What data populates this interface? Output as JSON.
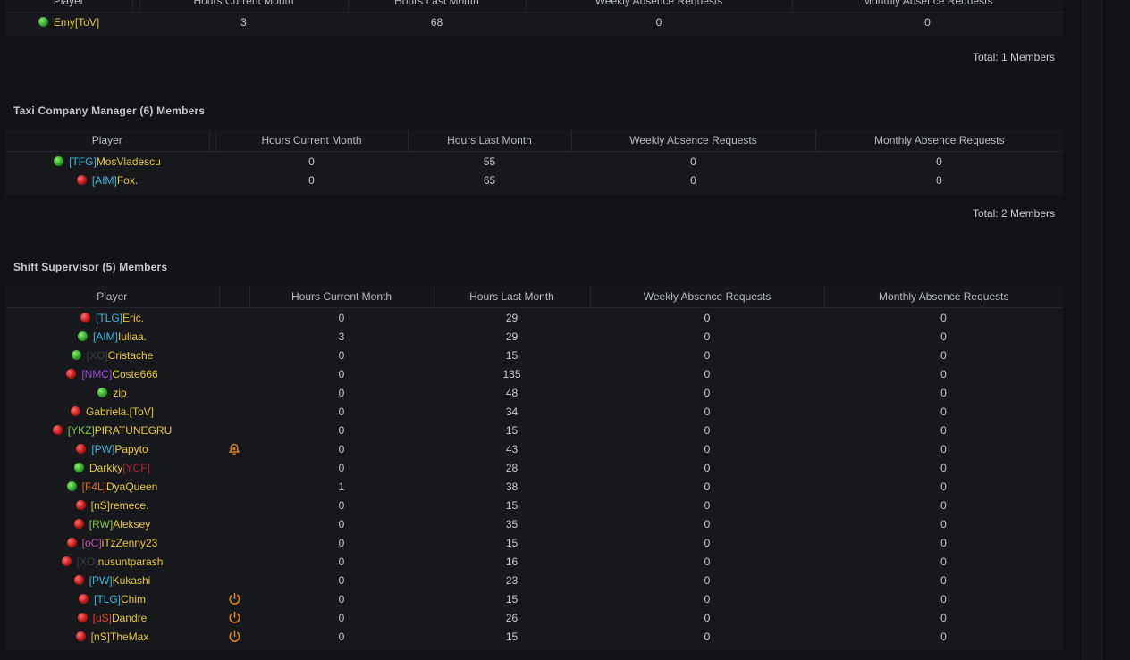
{
  "colors": {
    "bg": "#121316",
    "online": "#2fa12a",
    "offline": "#c01818",
    "icon": "#e0801a"
  },
  "headers": {
    "player": "Player",
    "hours_current": "Hours Current Month",
    "hours_last": "Hours Last Month",
    "weekly": "Weekly Absence Requests",
    "monthly": "Monthly Absence Requests"
  },
  "top_group": {
    "rows": [
      {
        "status": "online",
        "parts": [
          {
            "t": "Emy[ToV]",
            "c": "#e8c93a"
          }
        ],
        "cur": "3",
        "last": "68",
        "weekly": "0",
        "monthly": "0"
      }
    ],
    "total": "Total: 1 Members"
  },
  "taxi_group": {
    "title": "Taxi Company Manager (6) Members",
    "rows": [
      {
        "status": "online",
        "parts": [
          {
            "t": "[TFG]",
            "c": "#3fb6d9"
          },
          {
            "t": "MosVladescu",
            "c": "#e8c93a"
          }
        ],
        "cur": "0",
        "last": "55",
        "weekly": "0",
        "monthly": "0"
      },
      {
        "status": "offline",
        "parts": [
          {
            "t": "[AIM]",
            "c": "#3fb6d9"
          },
          {
            "t": "Fox.",
            "c": "#e8c93a"
          }
        ],
        "cur": "0",
        "last": "65",
        "weekly": "0",
        "monthly": "0"
      }
    ],
    "total": "Total: 2 Members"
  },
  "shift_group": {
    "title": "Shift Supervisor (5) Members",
    "rows": [
      {
        "status": "offline",
        "parts": [
          {
            "t": "[TLG]",
            "c": "#3fb6d9"
          },
          {
            "t": "Eric.",
            "c": "#e8c93a"
          }
        ],
        "icon": "",
        "cur": "0",
        "last": "29",
        "weekly": "0",
        "monthly": "0"
      },
      {
        "status": "online",
        "parts": [
          {
            "t": "[AIM]",
            "c": "#3fb6d9"
          },
          {
            "t": "Iuliaa.",
            "c": "#e8c93a"
          }
        ],
        "icon": "",
        "cur": "3",
        "last": "29",
        "weekly": "0",
        "monthly": "0"
      },
      {
        "status": "online",
        "parts": [
          {
            "t": "[XO]",
            "c": "#3a3d44"
          },
          {
            "t": "Cristache",
            "c": "#e8c93a"
          }
        ],
        "icon": "",
        "cur": "0",
        "last": "15",
        "weekly": "0",
        "monthly": "0"
      },
      {
        "status": "offline",
        "parts": [
          {
            "t": "[NMC]",
            "c": "#9b4fe0"
          },
          {
            "t": "Coste666",
            "c": "#e8c93a"
          }
        ],
        "icon": "",
        "cur": "0",
        "last": "135",
        "weekly": "0",
        "monthly": "0"
      },
      {
        "status": "online",
        "parts": [
          {
            "t": "zip",
            "c": "#e8c93a"
          }
        ],
        "icon": "",
        "cur": "0",
        "last": "48",
        "weekly": "0",
        "monthly": "0"
      },
      {
        "status": "offline",
        "parts": [
          {
            "t": "Gabriela.[ToV]",
            "c": "#e8c93a"
          }
        ],
        "icon": "",
        "cur": "0",
        "last": "34",
        "weekly": "0",
        "monthly": "0"
      },
      {
        "status": "offline",
        "parts": [
          {
            "t": "[YKZ]",
            "c": "#7ec94a"
          },
          {
            "t": "PIRATUNEGRU",
            "c": "#e8c93a"
          }
        ],
        "icon": "",
        "cur": "0",
        "last": "15",
        "weekly": "0",
        "monthly": "0"
      },
      {
        "status": "offline",
        "parts": [
          {
            "t": "[PW]",
            "c": "#3fb6d9"
          },
          {
            "t": "Papyto",
            "c": "#e8c93a"
          }
        ],
        "icon": "bell-icon",
        "cur": "0",
        "last": "43",
        "weekly": "0",
        "monthly": "0"
      },
      {
        "status": "online",
        "parts": [
          {
            "t": "Darkky",
            "c": "#e8c93a"
          },
          {
            "t": "[YCF]",
            "c": "#b0243a"
          }
        ],
        "icon": "",
        "cur": "0",
        "last": "28",
        "weekly": "0",
        "monthly": "0"
      },
      {
        "status": "online",
        "parts": [
          {
            "t": "[F4L]",
            "c": "#e56a1e"
          },
          {
            "t": "DyaQueen",
            "c": "#e8c93a"
          }
        ],
        "icon": "",
        "cur": "1",
        "last": "38",
        "weekly": "0",
        "monthly": "0"
      },
      {
        "status": "offline",
        "parts": [
          {
            "t": "[nS]",
            "c": "#e8c93a"
          },
          {
            "t": "remece.",
            "c": "#e8c93a"
          }
        ],
        "icon": "",
        "cur": "0",
        "last": "15",
        "weekly": "0",
        "monthly": "0"
      },
      {
        "status": "offline",
        "parts": [
          {
            "t": "[RW]",
            "c": "#7ec94a"
          },
          {
            "t": "Aleksey",
            "c": "#e8c93a"
          }
        ],
        "icon": "",
        "cur": "0",
        "last": "35",
        "weekly": "0",
        "monthly": "0"
      },
      {
        "status": "offline",
        "parts": [
          {
            "t": "[oC]",
            "c": "#c04fb0"
          },
          {
            "t": "iTzZenny23",
            "c": "#e8c93a"
          }
        ],
        "icon": "",
        "cur": "0",
        "last": "15",
        "weekly": "0",
        "monthly": "0"
      },
      {
        "status": "offline",
        "parts": [
          {
            "t": "[XO]",
            "c": "#3a3d44"
          },
          {
            "t": "nusuntparash",
            "c": "#e8c93a"
          }
        ],
        "icon": "",
        "cur": "0",
        "last": "16",
        "weekly": "0",
        "monthly": "0"
      },
      {
        "status": "offline",
        "parts": [
          {
            "t": "[PW]",
            "c": "#3fb6d9"
          },
          {
            "t": "Kukashi",
            "c": "#e8c93a"
          }
        ],
        "icon": "",
        "cur": "0",
        "last": "23",
        "weekly": "0",
        "monthly": "0"
      },
      {
        "status": "offline",
        "parts": [
          {
            "t": "[TLG]",
            "c": "#3fb6d9"
          },
          {
            "t": "Chim",
            "c": "#e8c93a"
          }
        ],
        "icon": "power-icon",
        "cur": "0",
        "last": "15",
        "weekly": "0",
        "monthly": "0"
      },
      {
        "status": "offline",
        "parts": [
          {
            "t": "[uS]",
            "c": "#e0472c"
          },
          {
            "t": "Dandre",
            "c": "#e8c93a"
          }
        ],
        "icon": "power-icon",
        "cur": "0",
        "last": "26",
        "weekly": "0",
        "monthly": "0"
      },
      {
        "status": "offline",
        "parts": [
          {
            "t": "[nS]",
            "c": "#e8c93a"
          },
          {
            "t": "TheMax",
            "c": "#e8c93a"
          }
        ],
        "icon": "power-icon",
        "cur": "0",
        "last": "15",
        "weekly": "0",
        "monthly": "0"
      }
    ]
  }
}
